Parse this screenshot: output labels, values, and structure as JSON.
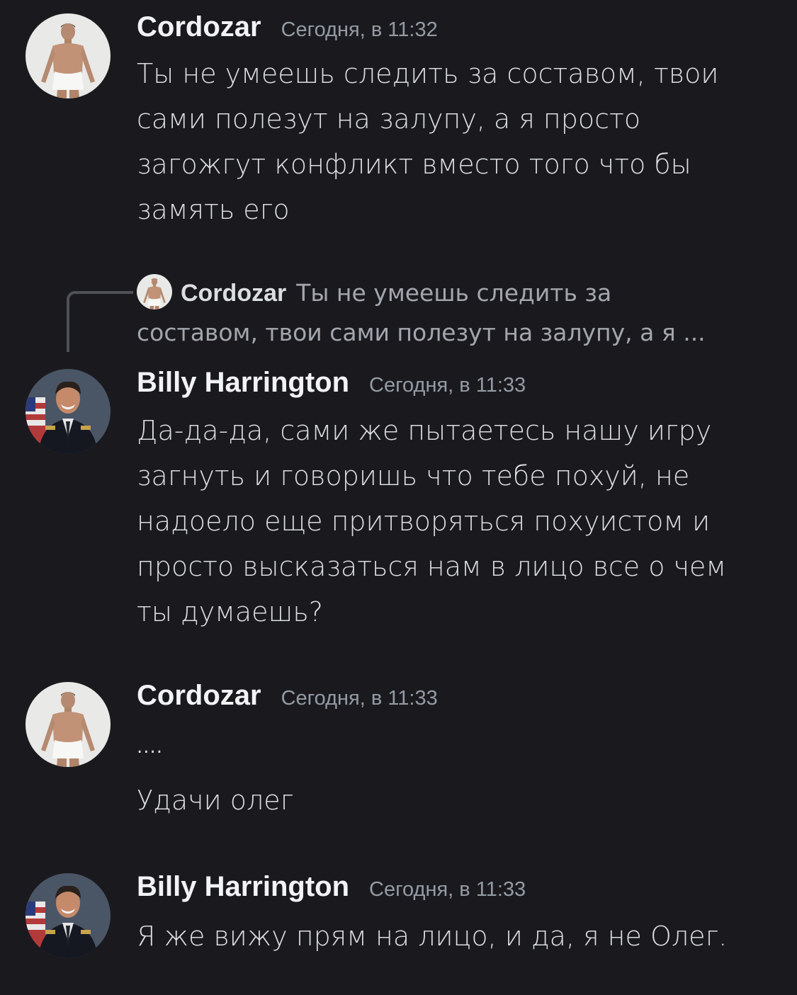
{
  "messages": [
    {
      "author": "Cordozar",
      "timestamp": "Сегодня, в 11:32",
      "avatar": "shirtless-man-avatar",
      "text": "Ты не умеешь следить за составом, твои\nсами полезут на залупу, а я просто\nзагожгут конфликт вместо того что бы\nзамять его"
    },
    {
      "author": "Billy Harrington",
      "timestamp": "Сегодня, в 11:33",
      "avatar": "uniformed-man-avatar",
      "reply_to": {
        "author": "Cordozar",
        "text_line1": "Ты не умеешь следить за",
        "text_line2": "составом, твои сами полезут на залупу, а я ..."
      },
      "text": "Да-да-да, сами же пытаетесь нашу игру\nзагнуть и говоришь что тебе похуй, не\nнадоело еще притворяться похуистом и\nпросто высказаться нам в лицо все о чем\nты думаешь?"
    },
    {
      "author": "Cordozar",
      "timestamp": "Сегодня, в 11:33",
      "avatar": "shirtless-man-avatar",
      "text_line1": "....",
      "text_line2": "Удачи олег"
    },
    {
      "author": "Billy Harrington",
      "timestamp": "Сегодня, в 11:33",
      "avatar": "uniformed-man-avatar",
      "text": "Я же вижу прям на лицо, и да, я не Олег."
    }
  ],
  "colors": {
    "background": "#1a1a1e",
    "author": "#f2f3f5",
    "timestamp": "#949ba4",
    "text": "#dbdee1",
    "reply_text": "#a3a6ad"
  }
}
